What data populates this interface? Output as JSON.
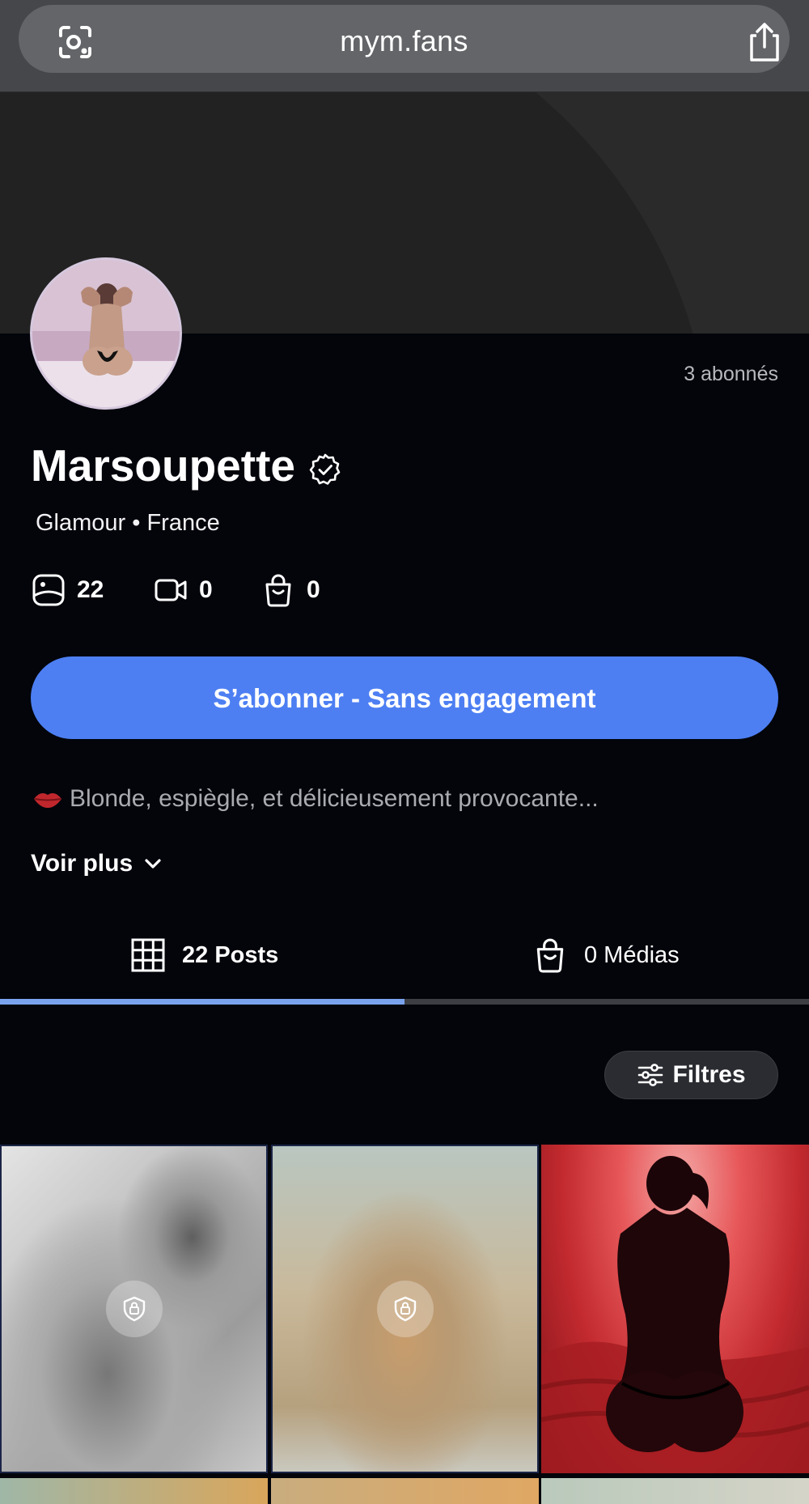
{
  "browser": {
    "url": "mym.fans",
    "lens_icon": "camera-lens-icon",
    "share_icon": "share-icon"
  },
  "profile": {
    "name": "Marsoupette",
    "verified": true,
    "subscribers": "3 abonnés",
    "category": "Glamour • France",
    "stats": {
      "photos": "22",
      "videos": "0",
      "shop": "0"
    },
    "subscribe_label": "S’abonner - Sans engagement",
    "bio": "Blonde, espiègle, et délicieusement provocante...",
    "voir_plus": "Voir plus"
  },
  "tabs": [
    {
      "label": "22 Posts",
      "icon": "grid-icon",
      "active": true
    },
    {
      "label": "0 Médias",
      "icon": "shopping-bag-icon",
      "active": false
    }
  ],
  "filters_label": "Filtres",
  "grid": {
    "tiles": [
      {
        "locked": true
      },
      {
        "locked": true
      },
      {
        "locked": false
      }
    ]
  },
  "colors": {
    "accent": "#4d7ff3",
    "tab_indicator": "#7aa3ee",
    "background": "#03050b"
  }
}
